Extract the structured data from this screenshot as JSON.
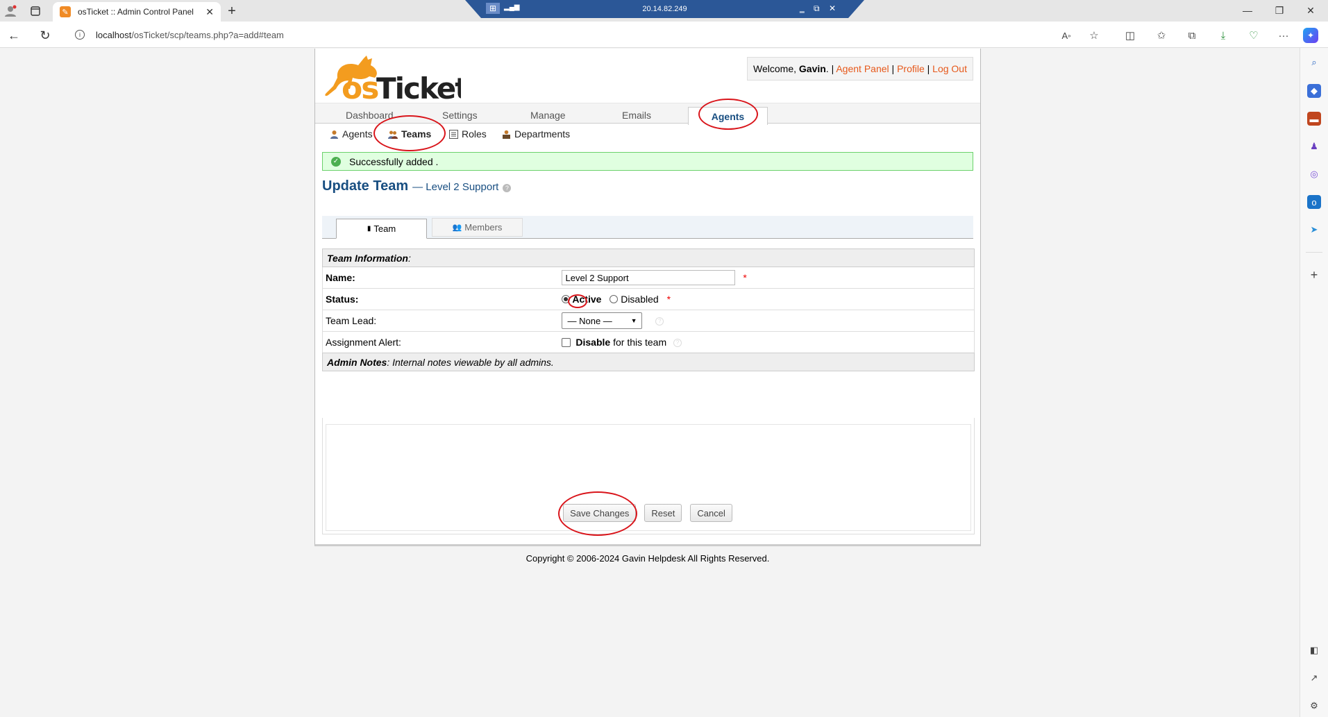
{
  "browser": {
    "tab_title": "osTicket :: Admin Control Panel",
    "url_host": "localhost",
    "url_path": "/osTicket/scp/teams.php?a=add#team",
    "rdp_ip": "20.14.82.249"
  },
  "header": {
    "logo_text": "osTicket",
    "welcome_prefix": "Welcome, ",
    "user_name": "Gavin",
    "agent_panel": "Agent Panel",
    "profile": "Profile",
    "log_out": "Log Out"
  },
  "nav": {
    "dashboard": "Dashboard",
    "settings": "Settings",
    "manage": "Manage",
    "emails": "Emails",
    "agents": "Agents"
  },
  "subnav": {
    "agents": "Agents",
    "teams": "Teams",
    "roles": "Roles",
    "departments": "Departments"
  },
  "message": {
    "success": "Successfully added ."
  },
  "page": {
    "title": "Update Team",
    "subtitle": "— Level 2 Support"
  },
  "tabs": {
    "team": "Team",
    "members": "Members"
  },
  "form": {
    "team_info_label": "Team Information",
    "name_label": "Name:",
    "name_value": "Level 2 Support",
    "status_label": "Status:",
    "status_active": "Active",
    "status_disabled": "Disabled",
    "team_lead_label": "Team Lead:",
    "team_lead_value": "— None —",
    "assignment_alert_label": "Assignment Alert:",
    "disable_bold": "Disable",
    "disable_rest": " for this team",
    "admin_notes_label": "Admin Notes",
    "admin_notes_desc": ": Internal notes viewable by all admins."
  },
  "buttons": {
    "save": "Save Changes",
    "reset": "Reset",
    "cancel": "Cancel"
  },
  "footer": {
    "copyright": "Copyright © 2006-2024 Gavin Helpdesk All Rights Reserved."
  },
  "colors": {
    "brand_blue": "#184e81",
    "link_orange": "#e6581a",
    "annotation_red": "#d9151b",
    "success_green": "#e0ffe0"
  }
}
